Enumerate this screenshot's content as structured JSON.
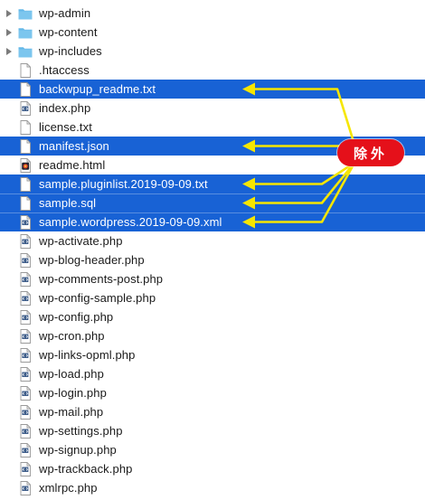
{
  "files": [
    {
      "name": "wp-admin",
      "kind": "folder",
      "icon": "folder-icon",
      "selected": false
    },
    {
      "name": "wp-content",
      "kind": "folder",
      "icon": "folder-icon",
      "selected": false
    },
    {
      "name": "wp-includes",
      "kind": "folder",
      "icon": "folder-icon",
      "selected": false
    },
    {
      "name": ".htaccess",
      "kind": "doc",
      "icon": "blank-document-icon",
      "selected": false
    },
    {
      "name": "backwpup_readme.txt",
      "kind": "doc",
      "icon": "document-icon",
      "selected": true
    },
    {
      "name": "index.php",
      "kind": "php",
      "icon": "php-file-icon",
      "selected": false
    },
    {
      "name": "license.txt",
      "kind": "doc",
      "icon": "document-icon",
      "selected": false
    },
    {
      "name": "manifest.json",
      "kind": "doc",
      "icon": "document-icon",
      "selected": true
    },
    {
      "name": "readme.html",
      "kind": "html",
      "icon": "html-file-icon",
      "selected": false
    },
    {
      "name": "sample.pluginlist.2019-09-09.txt",
      "kind": "doc",
      "icon": "document-icon",
      "selected": true
    },
    {
      "name": "sample.sql",
      "kind": "doc",
      "icon": "document-icon",
      "selected": true
    },
    {
      "name": "sample.wordpress.2019-09-09.xml",
      "kind": "php",
      "icon": "xml-file-icon",
      "selected": true
    },
    {
      "name": "wp-activate.php",
      "kind": "php",
      "icon": "php-file-icon",
      "selected": false
    },
    {
      "name": "wp-blog-header.php",
      "kind": "php",
      "icon": "php-file-icon",
      "selected": false
    },
    {
      "name": "wp-comments-post.php",
      "kind": "php",
      "icon": "php-file-icon",
      "selected": false
    },
    {
      "name": "wp-config-sample.php",
      "kind": "php",
      "icon": "php-file-icon",
      "selected": false
    },
    {
      "name": "wp-config.php",
      "kind": "php",
      "icon": "php-file-icon",
      "selected": false
    },
    {
      "name": "wp-cron.php",
      "kind": "php",
      "icon": "php-file-icon",
      "selected": false
    },
    {
      "name": "wp-links-opml.php",
      "kind": "php",
      "icon": "php-file-icon",
      "selected": false
    },
    {
      "name": "wp-load.php",
      "kind": "php",
      "icon": "php-file-icon",
      "selected": false
    },
    {
      "name": "wp-login.php",
      "kind": "php",
      "icon": "php-file-icon",
      "selected": false
    },
    {
      "name": "wp-mail.php",
      "kind": "php",
      "icon": "php-file-icon",
      "selected": false
    },
    {
      "name": "wp-settings.php",
      "kind": "php",
      "icon": "php-file-icon",
      "selected": false
    },
    {
      "name": "wp-signup.php",
      "kind": "php",
      "icon": "php-file-icon",
      "selected": false
    },
    {
      "name": "wp-trackback.php",
      "kind": "php",
      "icon": "php-file-icon",
      "selected": false
    },
    {
      "name": "xmlrpc.php",
      "kind": "php",
      "icon": "php-file-icon",
      "selected": false
    }
  ],
  "annotation": {
    "badge_label": "除外",
    "badge_color": "#e5101a",
    "arrow_color": "#f6e600"
  },
  "colors": {
    "selection": "#1862d5",
    "folder": "#7cc6ee"
  }
}
